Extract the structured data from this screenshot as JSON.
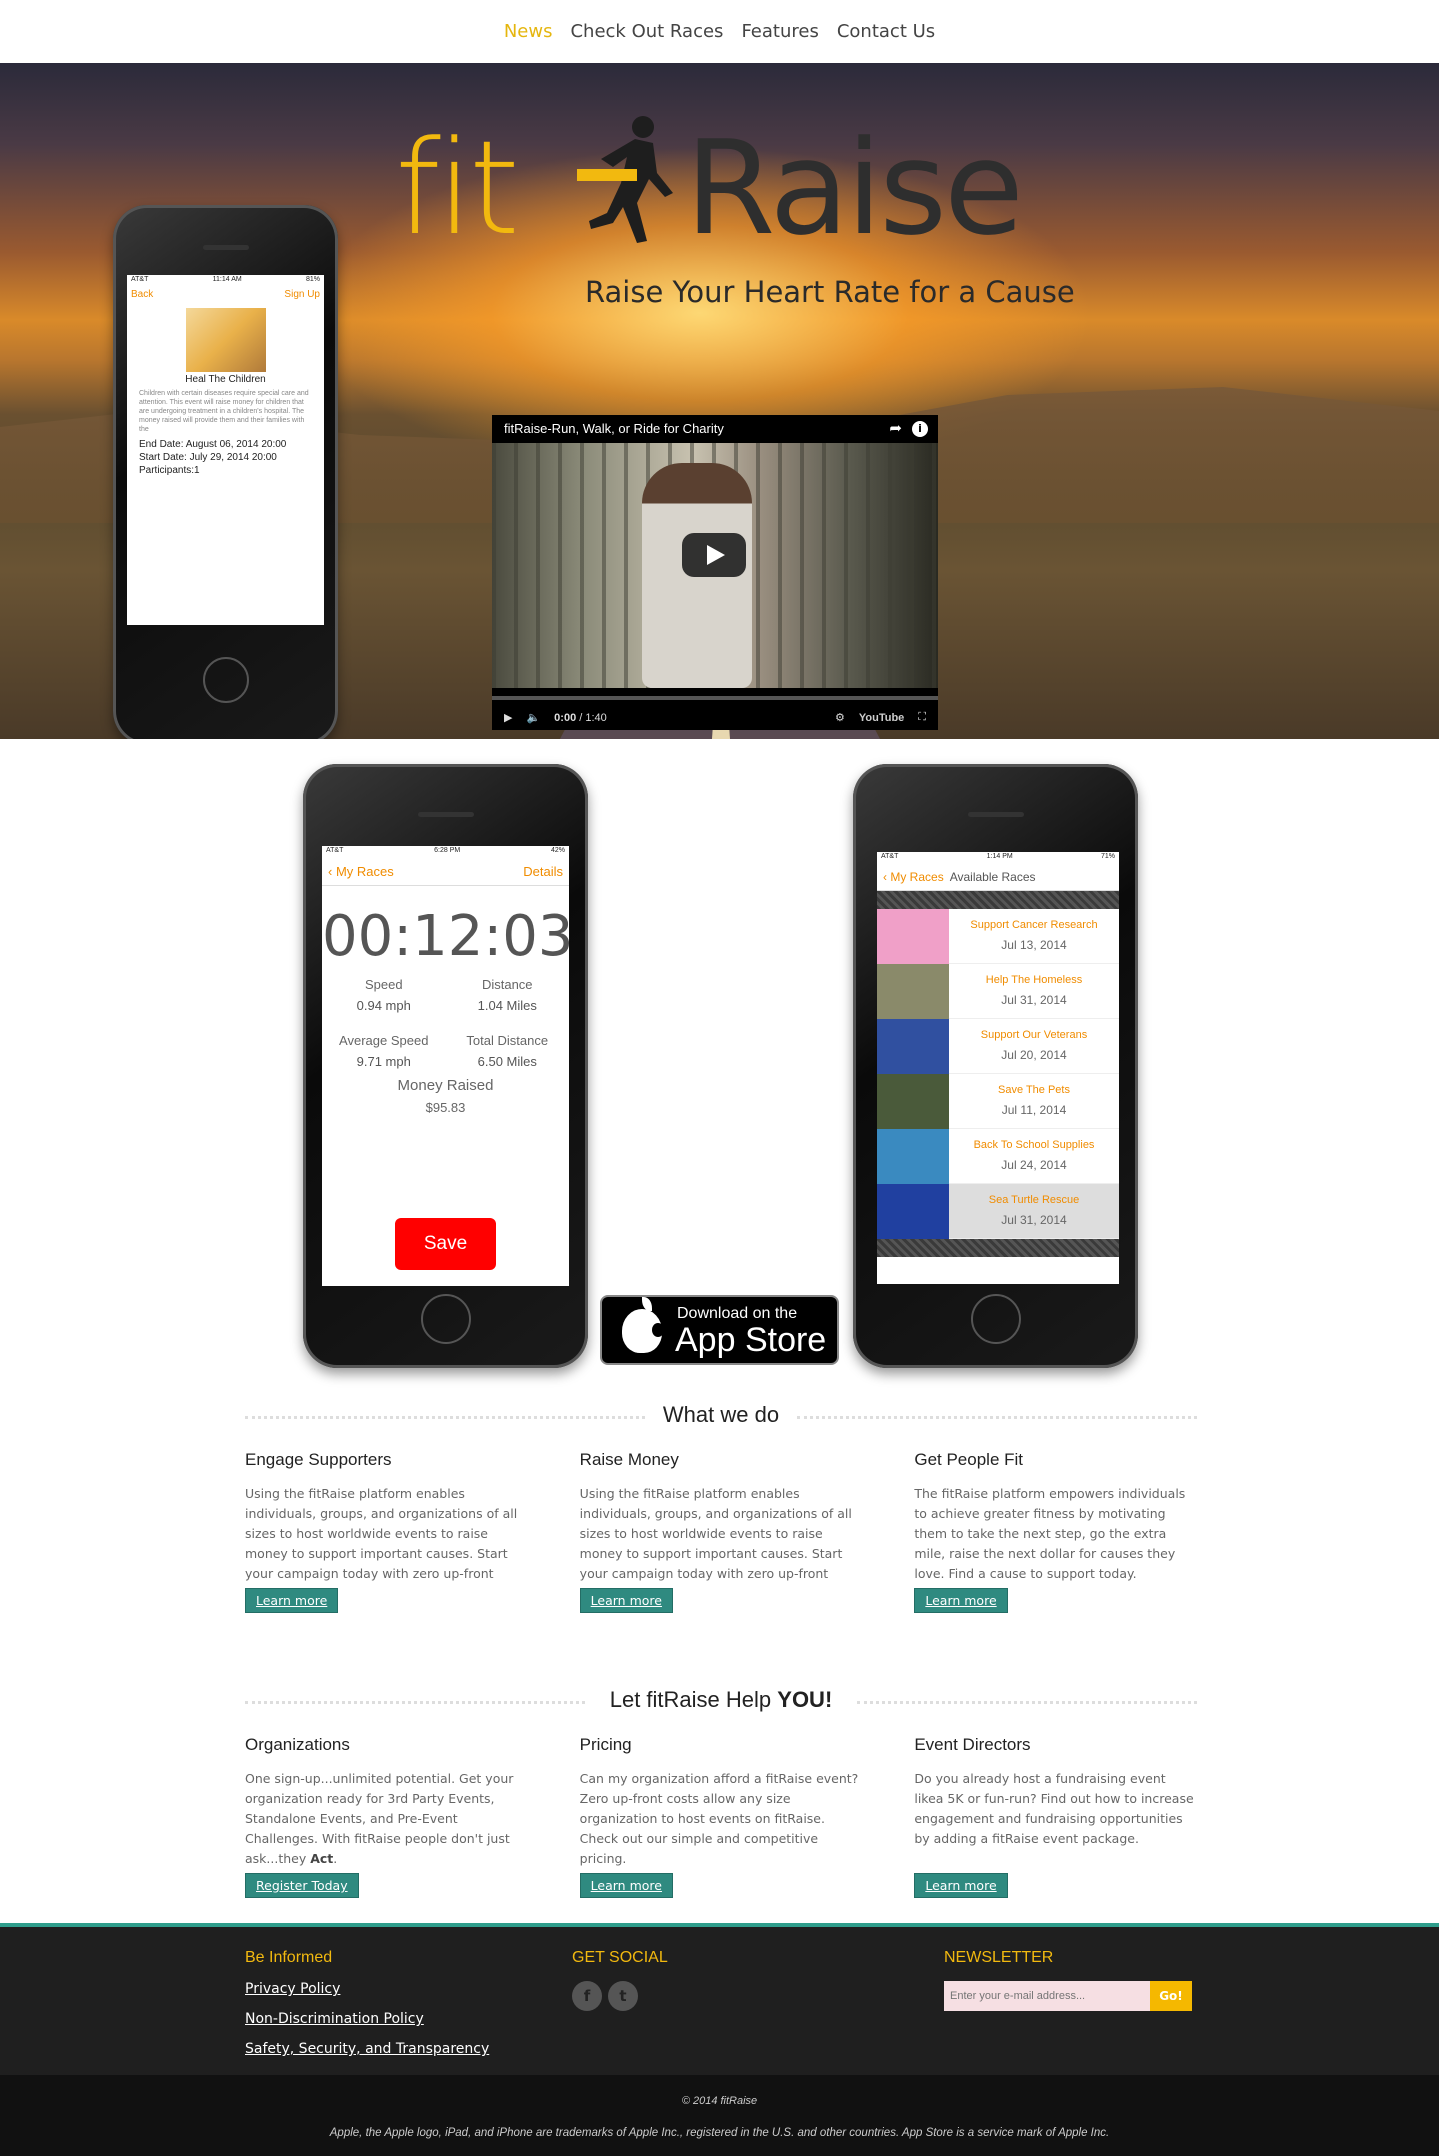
{
  "nav": {
    "items": [
      "News",
      "Check Out Races",
      "Features",
      "Contact Us"
    ],
    "active": "News"
  },
  "hero": {
    "logo_fit": "fit",
    "logo_raise": "Raise",
    "tagline": "Raise Your Heart Rate for a Cause",
    "phone": {
      "carrier": "AT&T",
      "time": "11:14 AM",
      "battery": "81%",
      "back": "Back",
      "signup": "Sign Up",
      "title": "Heal The Children",
      "description": "Children with certain diseases require special care and attention. This event will raise money for children that are undergoing treatment in a children's hospital. The money raised will provide them and their families with the",
      "end_date": "End Date: August 06, 2014 20:00",
      "start_date": "Start Date: July 29, 2014 20:00",
      "participants": "Participants:1"
    },
    "video": {
      "title": "fitRaise-Run, Walk, or Ride for Charity",
      "time_current": "0:00",
      "time_total": "/ 1:40",
      "brand": "YouTube"
    }
  },
  "phone_timer": {
    "carrier": "AT&T",
    "time": "6:28 PM",
    "battery": "42%",
    "back": "My Races",
    "details": "Details",
    "timer": "00:12:03",
    "stats": [
      {
        "label": "Speed",
        "value": "0.94 mph"
      },
      {
        "label": "Distance",
        "value": "1.04 Miles"
      },
      {
        "label": "Average Speed",
        "value": "9.71 mph"
      },
      {
        "label": "Total Distance",
        "value": "6.50 Miles"
      }
    ],
    "money_label": "Money Raised",
    "money_value": "$95.83",
    "save": "Save"
  },
  "appstore": {
    "line1": "Download on the",
    "line2": "App Store"
  },
  "phone_races": {
    "carrier": "AT&T",
    "time": "1:14 PM",
    "battery": "71%",
    "back": "My Races",
    "title": "Available Races",
    "races": [
      {
        "name": "Support Cancer Research",
        "date": "Jul 13, 2014",
        "color": "#f0a0c8"
      },
      {
        "name": "Help The Homeless",
        "date": "Jul 31, 2014",
        "color": "#8a8a6a"
      },
      {
        "name": "Support Our Veterans",
        "date": "Jul 20, 2014",
        "color": "#3050a0"
      },
      {
        "name": "Save The Pets",
        "date": "Jul 11, 2014",
        "color": "#4a5a3a"
      },
      {
        "name": "Back To School Supplies",
        "date": "Jul 24, 2014",
        "color": "#3a8ac0"
      },
      {
        "name": "Sea Turtle Rescue",
        "date": "Jul 31, 2014",
        "color": "#2040a0"
      }
    ]
  },
  "what_we_do": {
    "title": "What we do",
    "columns": [
      {
        "heading": "Engage Supporters",
        "text": "Using the fitRaise platform enables individuals, groups, and organizations of all sizes to host worldwide events to raise money to support important causes. Start your campaign today with zero up-front costs.",
        "button": "Learn more"
      },
      {
        "heading": "Raise Money",
        "text": "Using the fitRaise platform enables individuals, groups, and organizations of all sizes to host worldwide events to raise money to support important causes. Start your campaign today with zero up-front costs.",
        "button": "Learn more"
      },
      {
        "heading": "Get People Fit",
        "text": "The fitRaise platform empowers individuals to achieve greater fitness by motivating them to take the next step, go the extra mile, raise the next dollar for causes they love. Find a cause to support today.",
        "button": "Learn more"
      }
    ]
  },
  "help": {
    "title_pre": "Let fitRaise Help ",
    "title_bold": "YOU!",
    "columns": [
      {
        "heading": "Organizations",
        "text": "One sign-up...unlimited potential. Get your organization ready for 3rd Party Events, Standalone Events, and Pre-Event Challenges. With fitRaise people don't just ask...they ",
        "text_bold": "Act",
        "text_end": ".",
        "button": "Register Today"
      },
      {
        "heading": "Pricing",
        "text": "Can my organization afford a fitRaise event? Zero up-front costs allow any size organization to host events on fitRaise. Check out our simple and competitive pricing.",
        "text_bold": "",
        "text_end": "",
        "button": "Learn more"
      },
      {
        "heading": "Event Directors",
        "text": "Do you already host a fundraising event likea 5K or fun-run? Find out how to increase engagement and fundraising opportunities by adding a fitRaise event package.",
        "text_bold": "",
        "text_end": "",
        "button": "Learn more"
      }
    ]
  },
  "footer": {
    "informed_title": "Be Informed",
    "links": [
      "Privacy Policy",
      "Non-Discrimination Policy",
      "Safety, Security, and Transparency"
    ],
    "social_title": "GET SOCIAL",
    "social_icons": [
      "facebook-icon",
      "twitter-icon"
    ],
    "newsletter_title": "NEWSLETTER",
    "newsletter_placeholder": "Enter your e-mail address...",
    "go": "Go!",
    "copyright": "© 2014 fitRaise",
    "trademark": "Apple, the Apple logo, iPad, and iPhone are trademarks of Apple Inc., registered in the U.S. and other countries. App Store is a service mark of Apple Inc."
  },
  "colors": {
    "accent": "#e5b60e",
    "button": "#2f8a80",
    "orange": "#f08c00",
    "footer_line": "#2f9e8c"
  }
}
